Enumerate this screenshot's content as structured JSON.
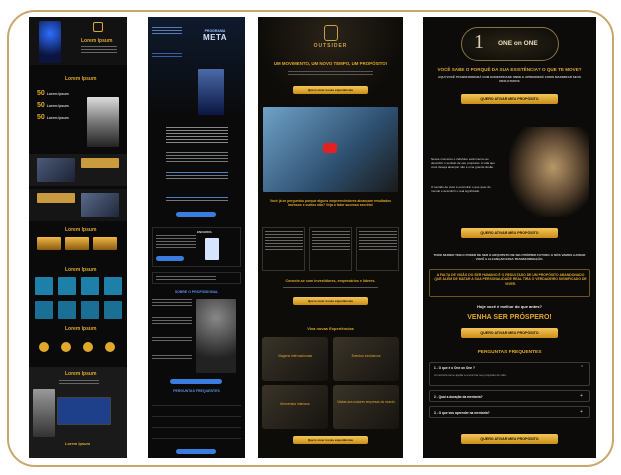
{
  "col1": {
    "heading1": "Lorem Ipsum",
    "heading2": "Lorem Ipsum",
    "stats": [
      {
        "num": "50",
        "label": "Lorem Ipsum"
      },
      {
        "num": "50",
        "label": "Lorem Ipsum"
      },
      {
        "num": "50",
        "label": "Lorem Ipsum"
      }
    ],
    "heading3": "Lorem Ipsum",
    "heading4": "Lorem Ipsum",
    "heading5": "Lorem Ipsum",
    "heading6": "Lorem Ipsum",
    "heading7": "Lorem Ipsum",
    "social_icons": [
      "facebook-icon",
      "instagram-icon",
      "youtube-icon",
      "linkedin-icon"
    ]
  },
  "col2": {
    "logo_line1": "PROGRAMA",
    "logo_line2": "META",
    "faq_title": "PERGUNTAS FREQUENTES",
    "section_title": "SOBRE O PROFISSIONAL",
    "badge": "ENCERRA"
  },
  "col3": {
    "brand": "OUTSIDER",
    "headline": "UM MOVIMENTO, UM NOVO TEMPO, UM PROPÓSITO!",
    "cta": "Quero viver novas experiências",
    "question": "Você já se perguntou porque alguns empreendedores alcançam resultados imensos e outros não? Veja o fator sucesso secreto!",
    "subhead": "Conecte-se com investidores, empresários e líderes.",
    "cta2": "Quero viver novas experiências",
    "exp_title": "Viva novas Experiências",
    "cards": [
      "Viagens internacionais",
      "Eventos exclusivos",
      "Momentos intensos",
      "Visitas aos maiores empresas do mundo"
    ],
    "cta3": "Quero viver novas experiências"
  },
  "col4": {
    "logo_num": "1",
    "logo_text": "ONE on ONE",
    "headline": "VOCÊ SABE O PORQUÊ DA SUA EXISTÊNCIA? O QUE TE MOVE?",
    "sub": "AQUI VOCÊ TRANSFORMARÁ COM HONESTIDADE ONDE E APRENDERÁ COMO MAXIMIZAR SEUS RESULTADOS",
    "cta": "QUERO ATIVAR MEU PROPÓSITO",
    "para1": "Nesse momento o individuo está imerso ao descobrir o sentido de seu propósito. A vida que você deseja alcançar não é uma grande ilusão.",
    "para2": "O sentido de viver é encontrar o que quer do mundo e descobrir o real significado.",
    "cta2": "QUERO ATIVAR MEU PROPÓSITO",
    "mid_text": "TODO MUNDO TEM O PODER DE SER O ARQUITETO DE SEU PRÓPRIO FUTURO. E NÓS VAMOS AJUDAR VOCÊ A ALCANÇAR ESSA TRANSFORMAÇÃO.",
    "highlight": "A FALTA DE VISÃO DO SER HUMANO É O RESULTADO DE UM PROPÓSITO ABANDONADO QUE ALÉM DE MATAR A SUA PERSONALIDADE REAL TIRA O VERDADEIRO SIGNIFICADO DE VIVER.",
    "question": "Hoje você é melhor do que antes?",
    "prospero": "VENHA SER PRÓSPERO!",
    "cta3": "QUERO ATIVAR MEU PROPÓSITO",
    "faq_title": "PERGUNTAS FREQUENTES",
    "faqs": [
      "1 - O que é o One on One ?",
      "2 - Qual a duração da mentoria?",
      "3 - O que vou aprender na mentoria?"
    ],
    "faq_answer": "A mentoria vai te ajudar a encontrar seu propósito de vida.",
    "cta4": "QUERO ATIVAR MEU PROPÓSITO"
  }
}
